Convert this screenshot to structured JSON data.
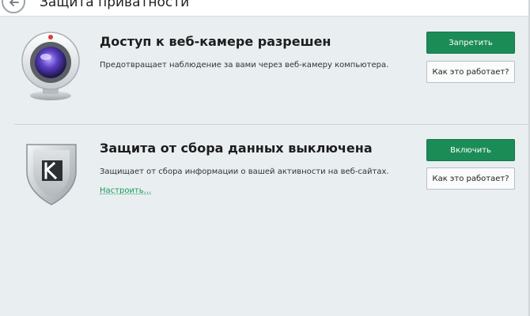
{
  "window": {
    "title": "Защита приватности"
  },
  "webcam": {
    "title": "Доступ к веб-камере разрешен",
    "description": "Предотвращает наблюдение за вами через веб-камеру компьютера.",
    "primary_button": "Запретить",
    "secondary_button": "Как это работает?",
    "icon": "webcam-icon"
  },
  "tracking": {
    "title": "Защита от сбора данных выключена",
    "description": "Защищает от сбора информации о вашей активности на веб-сайтах.",
    "settings_link": "Настроить...",
    "primary_button": "Включить",
    "secondary_button": "Как это работает?",
    "icon": "kaspersky-shield-icon"
  },
  "colors": {
    "accent_green": "#1c8c57",
    "link_green": "#1a9a5c",
    "background": "#e9eef0"
  }
}
